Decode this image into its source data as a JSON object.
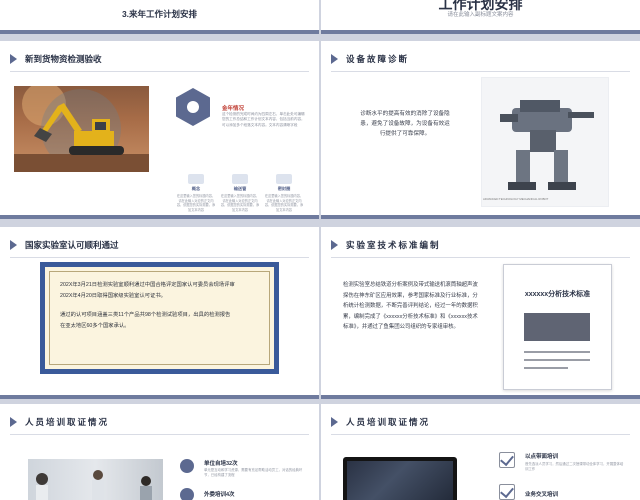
{
  "slide_plan": {
    "title": "3.来年工作计划安排"
  },
  "slide_subtitle": {
    "title": "工作计划安排",
    "placeholder_text": "请在此输入副标题文案内容"
  },
  "slide_inspection": {
    "title": "新到货物资检测验收",
    "info_title": "金年情况",
    "info_body": "这个检测的完成时间约为四周左右，单击此处可编辑您的工作总结和工作计划文本内容，包括当前内容，可以添加多个段落文本内容。文本内容清晰字段",
    "columns": [
      {
        "label": "概念",
        "body": "在这里输入您的标题内容，请在此输入对应的正文内容，依据您的实际需要。添加文本内容"
      },
      {
        "label": "输送管",
        "body": "在这里输入您的标题内容，请在此输入对应的正文内容，依据您的实际需要。添加文本内容"
      },
      {
        "label": "密封圈",
        "body": "在这里输入您的标题内容，请在此输入对应的正文内容，依据您的实际需要。添加文本内容"
      }
    ]
  },
  "slide_diagnosis": {
    "title": "设备故障诊断",
    "body": "诊断水平的提高有效的消除了设备隐患，避免了设备故障，为设备有效运行提供了可靠保障。",
    "photo_caption": "ADVANCED TECHNOLOGY MECHANICAL ROBOT"
  },
  "slide_lab": {
    "title": "国家实验室认可顺利通过",
    "lines": [
      "202X年3月21日检测实验室顺利通过中国合格评定国家认可委员会现场评审",
      "202X年4月20日取得国家级实验室认可证书。",
      "",
      "通过的认可项目涵盖三类11个产品共98个检测试验项目，出具的检测报告",
      "在亚太地区60多个国家承认。"
    ]
  },
  "slide_standards": {
    "title": "实验室技术标准编制",
    "body": "检测实验室总结铁道分析案例及带式输送机滚筒轴超声波探伤在神东矿区应用效果，参考国家标准及行业标准，分析统计检测数据，不断完善评判结论，经过一年的数据积累，编制完成了《xxxxxx分析技术标准》和《xxxxxx技术标准》，并通过了鱼集团公司组织的专家组审核。",
    "doc_title": "xxxxxx分析技术标准"
  },
  "slide_training_left": {
    "title": "人员培训取证情况",
    "stats": [
      {
        "label": "单位自培32次",
        "body": "单元是互动和学习资源，需要有充足帮助活动员工，对话的经典环节，已经构建了流程"
      },
      {
        "label": "外委培训4次",
        "body": "外委培训"
      }
    ]
  },
  "slide_training_right": {
    "title": "人员培训取证情况",
    "items": [
      {
        "label": "以点带面培训",
        "body": "首先选派人员学习，然后通过二次授课带动全体学习，开展整体培训工作"
      },
      {
        "label": "业务交叉培训",
        "body": "业务交叉培训"
      }
    ]
  }
}
